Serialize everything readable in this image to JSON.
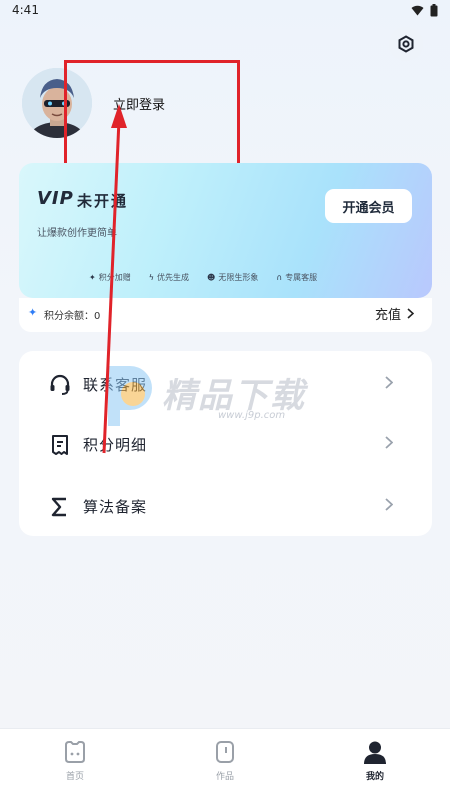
{
  "status_bar": {
    "time": "4:41"
  },
  "profile": {
    "login_label": "立即登录"
  },
  "vip": {
    "logo": "VIP",
    "status": "未开通",
    "subtitle": "让爆款创作更简单",
    "button": "开通会员",
    "perks": [
      {
        "icon": "sparkle-icon",
        "label": "积分加赠"
      },
      {
        "icon": "lightning-icon",
        "label": "优先生成"
      },
      {
        "icon": "face-icon",
        "label": "无限生形象"
      },
      {
        "icon": "headset-icon",
        "label": "专属客服"
      }
    ]
  },
  "balance": {
    "label": "积分余额：0",
    "recharge": "充值"
  },
  "menu": {
    "items": [
      {
        "icon": "headset-icon",
        "label": "联系客服"
      },
      {
        "icon": "receipt-icon",
        "label": "积分明细"
      },
      {
        "icon": "sigma-icon",
        "label": "算法备案"
      }
    ]
  },
  "watermark": {
    "title": "精品下载",
    "url": "www.j9p.com"
  },
  "tabs": [
    {
      "label": "首页",
      "active": false
    },
    {
      "label": "作品",
      "active": false
    },
    {
      "label": "我的",
      "active": true
    }
  ],
  "colors": {
    "annotation": "#e0232a",
    "accent": "#2f7df6",
    "card_bg": "#ffffff"
  }
}
